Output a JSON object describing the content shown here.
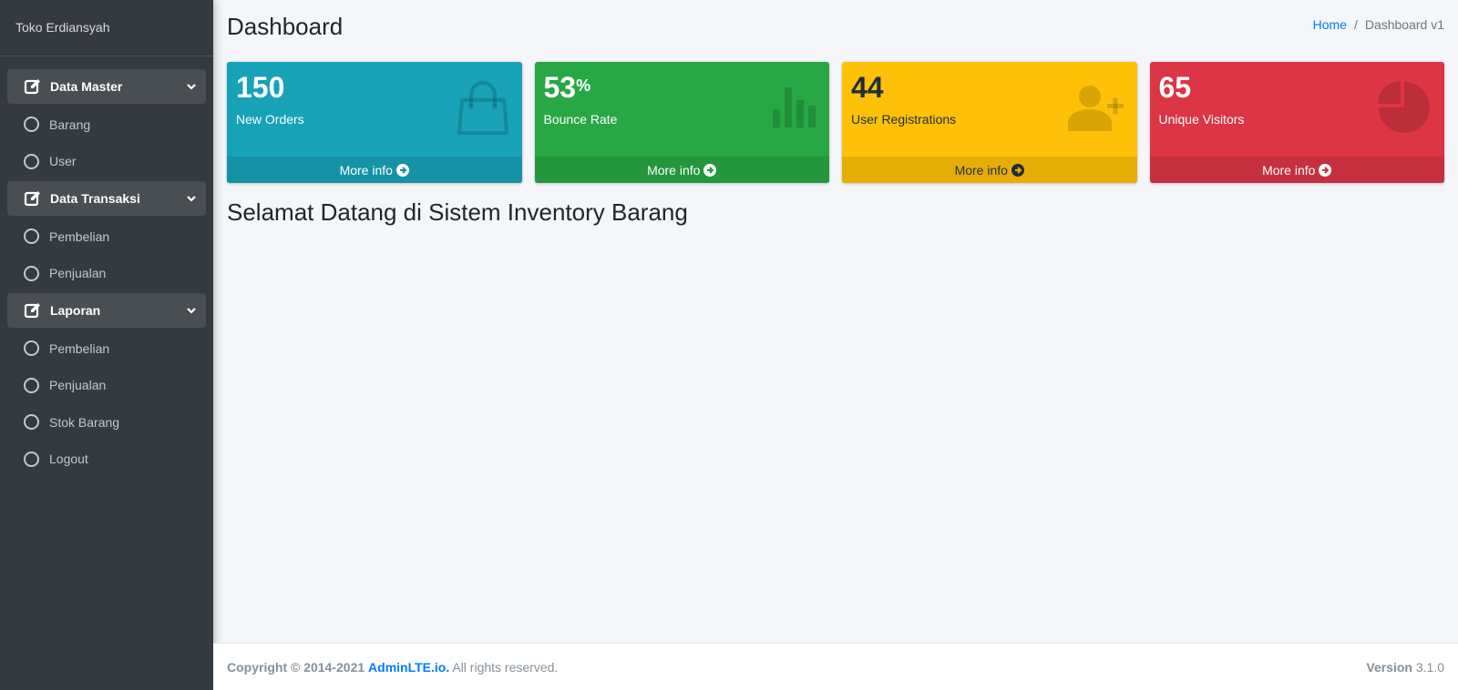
{
  "sidebar": {
    "brand": "Toko Erdiansyah",
    "sections": [
      {
        "label": "Data Master",
        "items": [
          "Barang",
          "User"
        ]
      },
      {
        "label": "Data Transaksi",
        "items": [
          "Pembelian",
          "Penjualan"
        ]
      },
      {
        "label": "Laporan",
        "items": [
          "Pembelian",
          "Penjualan",
          "Stok Barang",
          "Logout"
        ]
      }
    ]
  },
  "header": {
    "title": "Dashboard",
    "breadcrumb": {
      "home": "Home",
      "separator": "/",
      "current": "Dashboard v1"
    }
  },
  "boxes": [
    {
      "value": "150",
      "suffix": "",
      "label": "New Orders",
      "link": "More info",
      "icon": "shopping-bag-icon",
      "color": "#17a2b8"
    },
    {
      "value": "53",
      "suffix": "%",
      "label": "Bounce Rate",
      "link": "More info",
      "icon": "bar-chart-icon",
      "color": "#28a745"
    },
    {
      "value": "44",
      "suffix": "",
      "label": "User Registrations",
      "link": "More info",
      "icon": "user-plus-icon",
      "color": "#ffc107"
    },
    {
      "value": "65",
      "suffix": "",
      "label": "Unique Visitors",
      "link": "More info",
      "icon": "pie-chart-icon",
      "color": "#dc3545"
    }
  ],
  "content": {
    "welcome": "Selamat Datang di Sistem Inventory Barang"
  },
  "footer": {
    "copyright": "Copyright © 2014-2021",
    "brand": "AdminLTE.io.",
    "rights": "All rights reserved.",
    "version_label": "Version",
    "version": "3.1.0"
  }
}
